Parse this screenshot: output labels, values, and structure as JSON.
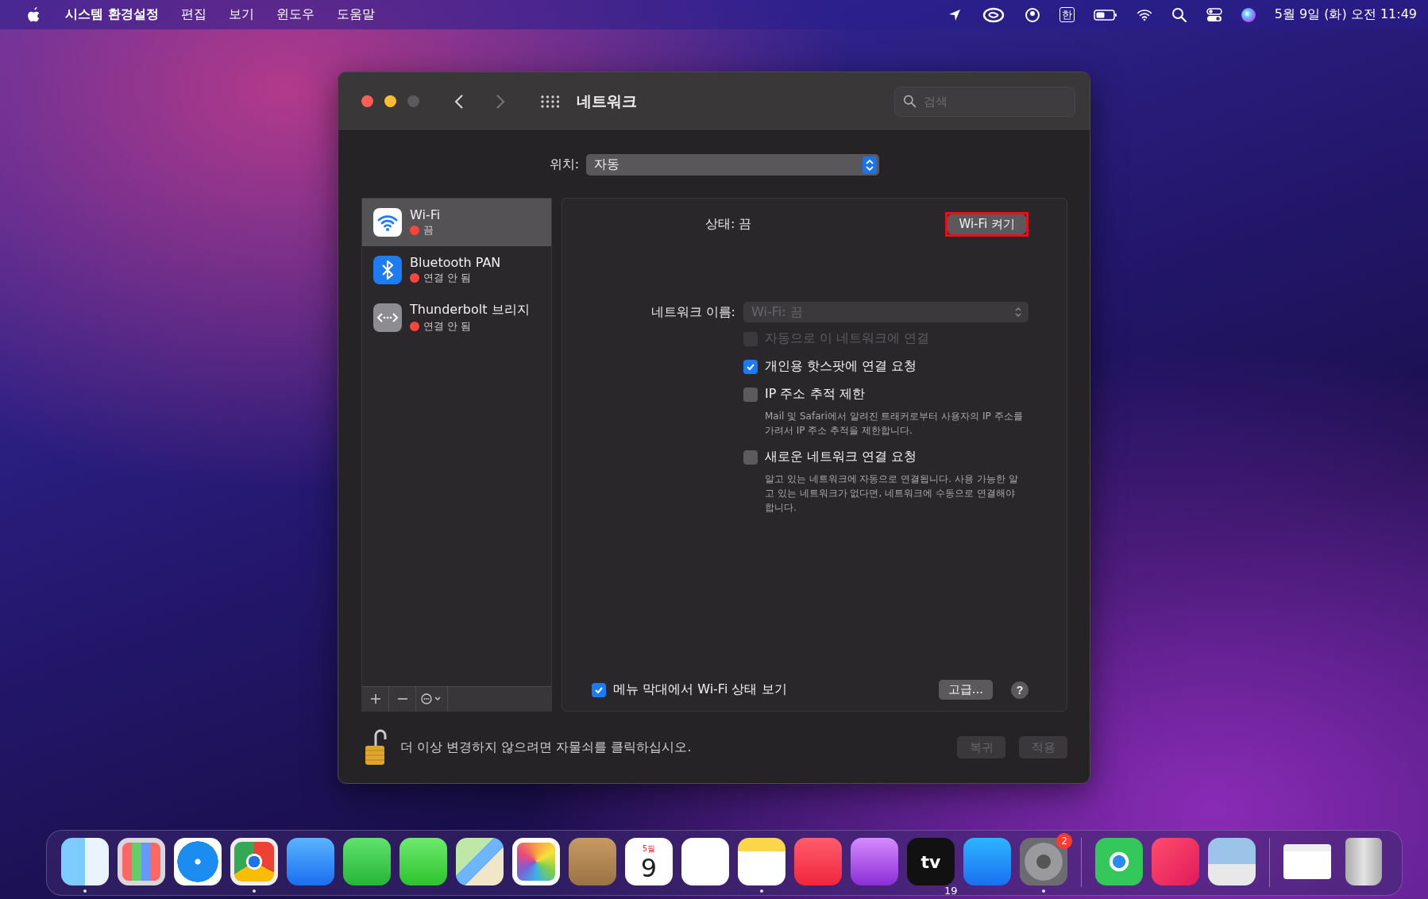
{
  "menu_bar": {
    "app_name": "시스템 환경설정",
    "menus": [
      "편집",
      "보기",
      "윈도우",
      "도움말"
    ],
    "input_source": "한",
    "clock": "5월 9일 (화) 오전 11:49"
  },
  "window": {
    "title": "네트워크",
    "search": {
      "placeholder": "검색"
    },
    "location": {
      "label": "위치:",
      "value": "자동"
    },
    "services": [
      {
        "name": "Wi-Fi",
        "kind": "wifi",
        "status": "끔",
        "selected": true,
        "color": "#ff453a"
      },
      {
        "name": "Bluetooth PAN",
        "kind": "bluetooth",
        "status": "연결 안 됨",
        "selected": false,
        "color": "#ff453a"
      },
      {
        "name": "Thunderbolt 브리지",
        "kind": "thunderbolt",
        "status": "연결 안 됨",
        "selected": false,
        "color": "#ff453a"
      }
    ],
    "detail": {
      "status_label": "상태:",
      "status_value": "끔",
      "toggle_button": {
        "label": "Wi-Fi 켜기",
        "highlighted": true
      },
      "network_name": {
        "label": "네트워크 이름:",
        "value": "Wi-Fi: 끔",
        "disabled": true
      },
      "options": [
        {
          "label": "자동으로 이 네트워크에 연결",
          "checked": false,
          "disabled": true
        },
        {
          "label": "개인용 핫스팟에 연결 요청",
          "checked": true,
          "disabled": false
        },
        {
          "label": "IP 주소 추적 제한",
          "checked": false,
          "disabled": false,
          "description": "Mail 및 Safari에서 알려진 트래커로부터 사용자의 IP 주소를 가려서 IP 주소 추적을 제한합니다."
        },
        {
          "label": "새로운 네트워크 연결 요청",
          "checked": false,
          "disabled": false,
          "description": "알고 있는 네트워크에 자동으로 연결됩니다. 사용 가능한 알고 있는 네트워크가 없다면, 네트워크에 수동으로 연결해야 합니다."
        }
      ],
      "menu_bar_option": {
        "label": "메뉴 막대에서 Wi-Fi 상태 보기",
        "checked": true
      },
      "advanced_button": "고급...",
      "help_button": "?"
    },
    "lock": {
      "message": "더 이상 변경하지 않으려면 자물쇠를 클릭하십시오.",
      "locked": false
    },
    "footer_buttons": [
      {
        "label": "복귀",
        "disabled": true
      },
      {
        "label": "적용",
        "disabled": true
      }
    ]
  },
  "dock": {
    "apps": [
      {
        "kind": "finder",
        "running": true
      },
      {
        "kind": "launchpad",
        "running": false
      },
      {
        "kind": "safari",
        "running": false
      },
      {
        "kind": "chrome",
        "running": true
      },
      {
        "kind": "mail",
        "running": false
      },
      {
        "kind": "facetime",
        "running": false
      },
      {
        "kind": "messages",
        "running": false
      },
      {
        "kind": "maps",
        "running": false
      },
      {
        "kind": "photos",
        "running": false
      },
      {
        "kind": "contacts",
        "running": false
      },
      {
        "kind": "calendar",
        "running": false,
        "month": "5월",
        "day": "9"
      },
      {
        "kind": "reminders",
        "running": false
      },
      {
        "kind": "notes",
        "running": true
      },
      {
        "kind": "music",
        "running": false
      },
      {
        "kind": "podcasts",
        "running": false
      },
      {
        "kind": "tv",
        "running": false,
        "label": "tv"
      },
      {
        "kind": "appstore",
        "running": false
      },
      {
        "kind": "settings",
        "running": true,
        "badge": "2"
      }
    ],
    "utilities": [
      {
        "kind": "findmy",
        "running": false
      },
      {
        "kind": "creative-cloud",
        "running": false
      },
      {
        "kind": "preview",
        "running": false
      }
    ],
    "documents": [
      {
        "kind": "window-thumbnail",
        "running": false
      },
      {
        "kind": "trash",
        "running": false
      }
    ],
    "overlay_text": "19"
  }
}
